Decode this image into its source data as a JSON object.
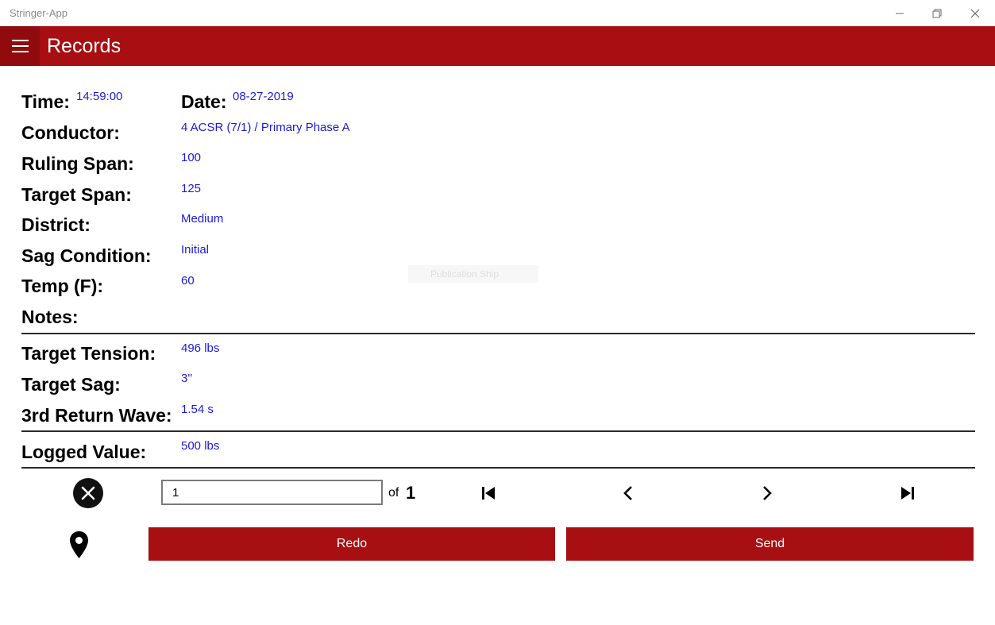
{
  "window": {
    "title": "Stringer-App"
  },
  "header": {
    "title": "Records"
  },
  "record": {
    "time_label": "Time:",
    "time_value": "14:59:00",
    "date_label": "Date:",
    "date_value": "08-27-2019",
    "conductor_label": "Conductor:",
    "conductor_value": "4 ACSR (7/1) / Primary Phase A",
    "ruling_span_label": "Ruling Span:",
    "ruling_span_value": "100",
    "target_span_label": "Target Span:",
    "target_span_value": "125",
    "district_label": "District:",
    "district_value": "Medium",
    "sag_condition_label": "Sag Condition:",
    "sag_condition_value": "Initial",
    "temp_label": "Temp (F):",
    "temp_value": "60",
    "notes_label": "Notes:",
    "target_tension_label": "Target Tension:",
    "target_tension_value": "496 lbs",
    "target_sag_label": "Target Sag:",
    "target_sag_value": "3''",
    "return_wave_label": "3rd Return Wave:",
    "return_wave_value": "1.54 s",
    "logged_value_label": "Logged Value:",
    "logged_value_value": "500 lbs"
  },
  "ghost": {
    "text": "Publication Ship"
  },
  "pager": {
    "current_page": "1",
    "of_label": "of",
    "total_pages": "1"
  },
  "actions": {
    "redo_label": "Redo",
    "send_label": "Send"
  },
  "icons": {
    "menu": "hamburger-icon",
    "cancel": "close-circle-icon",
    "first": "first-page-icon",
    "prev": "chevron-left-icon",
    "next": "chevron-right-icon",
    "last": "last-page-icon",
    "location": "map-pin-icon"
  },
  "colors": {
    "accent": "#a70f12",
    "value_text": "#1a1ae0"
  }
}
